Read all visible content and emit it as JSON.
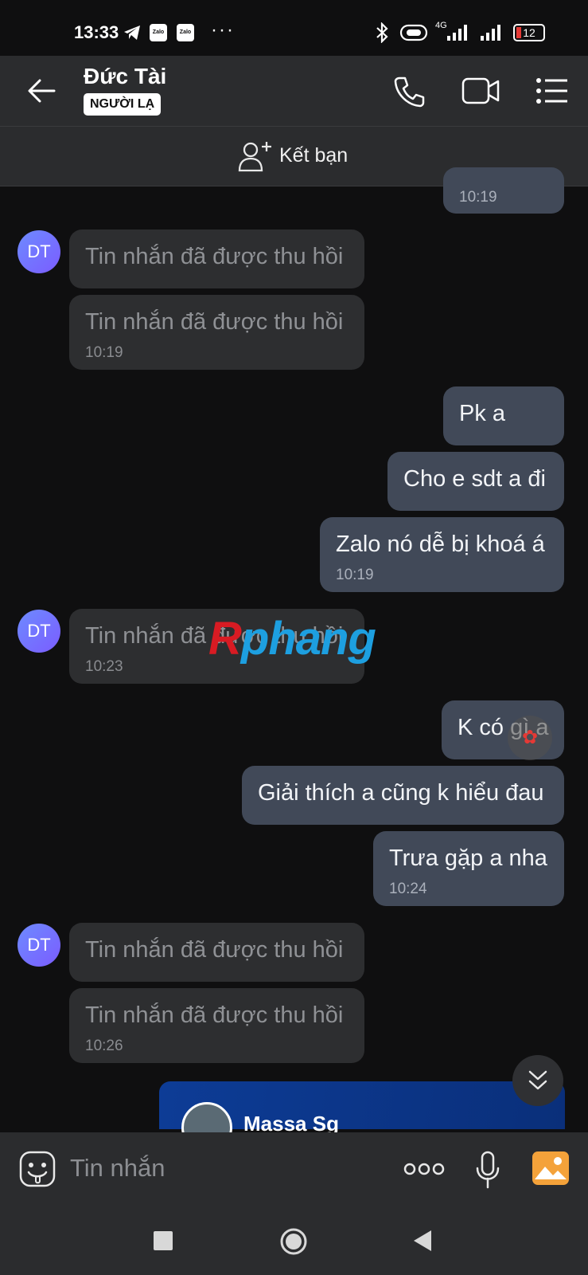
{
  "status_bar": {
    "time": "13:33",
    "notif_app1": "Zalo",
    "notif_app2": "Zalo",
    "more": "···",
    "network": "4G",
    "battery": "12"
  },
  "header": {
    "contact_name": "Đức Tài",
    "badge": "NGƯỜI LẠ"
  },
  "add_friend": {
    "label": "Kết bạn"
  },
  "messages": [
    {
      "time": "10:19"
    },
    {
      "text": "Tin nhắn đã được thu hồi"
    },
    {
      "text": "Tin nhắn đã được thu hồi",
      "time": "10:19"
    },
    {
      "text": "Pk a"
    },
    {
      "text": "Cho e sdt a đi"
    },
    {
      "text": "Zalo nó dễ bị khoá á",
      "time": "10:19"
    },
    {
      "text": "Tin nhắn đã được thu hồi",
      "time": "10:23"
    },
    {
      "text": "K có gì a"
    },
    {
      "text": "Giải thích a cũng k hiểu đau"
    },
    {
      "text": "Trưa gặp a nha",
      "time": "10:24"
    },
    {
      "text": "Tin nhắn đã được thu hồi"
    },
    {
      "text": "Tin nhắn đã được thu hồi",
      "time": "10:26"
    }
  ],
  "avatar_initials": "DT",
  "watermark": {
    "first": "R",
    "rest": "phang"
  },
  "shared_card": {
    "title": "Massa Sg"
  },
  "composer": {
    "placeholder": "Tin nhắn"
  }
}
